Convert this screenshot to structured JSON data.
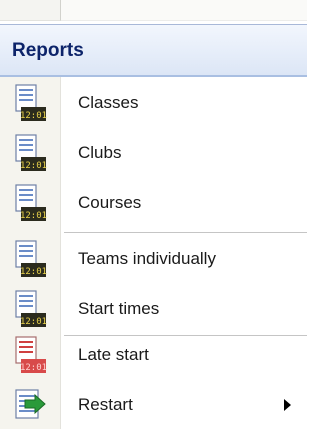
{
  "menu": {
    "header": "Reports",
    "items": [
      {
        "label": "Classes",
        "icon": "report-clock-icon",
        "icon_color": "#5a7ab6"
      },
      {
        "label": "Clubs",
        "icon": "report-clock-icon",
        "icon_color": "#5a7ab6"
      },
      {
        "label": "Courses",
        "icon": "report-clock-icon",
        "icon_color": "#5a7ab6"
      },
      {
        "label": "Teams individually",
        "icon": "report-clock-icon",
        "icon_color": "#5a7ab6"
      },
      {
        "label": "Start times",
        "icon": "report-clock-icon",
        "icon_color": "#5a7ab6"
      },
      {
        "label": "Late start",
        "icon": "late-report-clock-icon",
        "icon_color": "#c03030"
      },
      {
        "label": "Restart",
        "icon": "restart-arrow-icon",
        "icon_color": "#2a9a3a",
        "has_submenu": true
      }
    ],
    "clock_text": "12:01"
  }
}
